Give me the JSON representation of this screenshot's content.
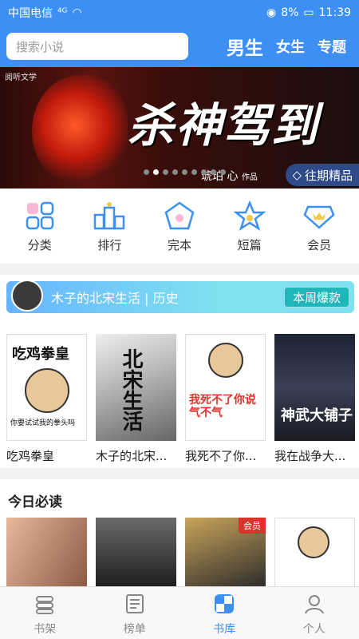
{
  "status": {
    "carrier": "中国电信",
    "battery": "8%",
    "time": "11:39"
  },
  "header": {
    "search_placeholder": "搜索小说",
    "tabs": [
      "男生",
      "女生",
      "专题"
    ]
  },
  "banner": {
    "title": "杀神驾到",
    "author": "琥珀 心",
    "author_tag": "作品",
    "badge": "往期精品",
    "logo": "阅听文学"
  },
  "categories": [
    {
      "label": "分类",
      "icon": "grid-icon"
    },
    {
      "label": "排行",
      "icon": "podium-icon"
    },
    {
      "label": "完本",
      "icon": "pentagon-icon"
    },
    {
      "label": "短篇",
      "icon": "star-icon"
    },
    {
      "label": "会员",
      "icon": "crown-icon"
    }
  ],
  "history": {
    "text": "木子的北宋生活 | 历史",
    "week_label": "本周爆款"
  },
  "books": [
    {
      "title": "吃鸡拳皇",
      "cover_text": "吃鸡拳皇",
      "cover_sub": "你要试试我的拳头吗"
    },
    {
      "title": "木子的北宋...",
      "cover_text": "北宋生活"
    },
    {
      "title": "我死不了你...",
      "cover_text": "我死不了你说气不气"
    },
    {
      "title": "我在战争大...",
      "cover_text": "神武大铺子"
    }
  ],
  "today": {
    "heading": "今日必读",
    "vip_label": "会员"
  },
  "nav": [
    {
      "label": "书架",
      "icon": "bookshelf-icon"
    },
    {
      "label": "榜单",
      "icon": "ranking-icon"
    },
    {
      "label": "书库",
      "icon": "library-icon"
    },
    {
      "label": "个人",
      "icon": "user-icon"
    }
  ],
  "colors": {
    "brand": "#3d8ff3"
  }
}
